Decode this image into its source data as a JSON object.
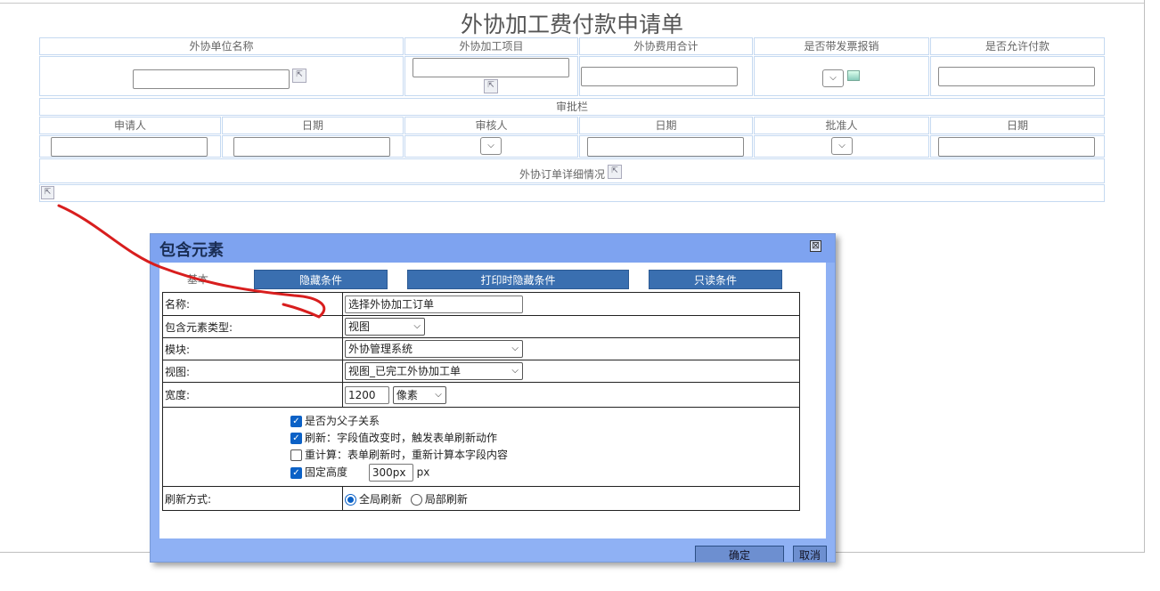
{
  "form": {
    "title": "外协加工费付款申请单",
    "headers": [
      "外协单位名称",
      "外协加工项目",
      "外协费用合计",
      "是否带发票报销",
      "是否允许付款"
    ],
    "approval_title": "审批栏",
    "approval_headers": [
      "申请人",
      "日期",
      "审核人",
      "日期",
      "批准人",
      "日期"
    ],
    "detail_title": "外协订单详细情况"
  },
  "dialog": {
    "title": "包含元素",
    "close_glyph": "⊠",
    "tabs": [
      "基本",
      "隐藏条件",
      "打印时隐藏条件",
      "只读条件"
    ],
    "rows": {
      "name_label": "名称:",
      "name_value": "选择外协加工订单",
      "type_label": "包含元素类型:",
      "type_value": "视图",
      "module_label": "模块:",
      "module_value": "外协管理系统",
      "view_label": "视图:",
      "view_value": "视图_已完工外协加工单",
      "width_label": "宽度:",
      "width_value": "1200",
      "width_unit": "像素",
      "opt_parent": "是否为父子关系",
      "opt_refresh": "刷新：字段值改变时，触发表单刷新动作",
      "opt_recalc": "重计算：表单刷新时，重新计算本字段内容",
      "opt_fixed": "固定高度",
      "fixed_value": "300px",
      "fixed_unit": "px",
      "refresh_label": "刷新方式:",
      "refresh_all": "全局刷新",
      "refresh_part": "局部刷新"
    },
    "checks": {
      "parent": true,
      "refresh": true,
      "recalc": false,
      "fixed": true
    },
    "refresh_mode": "全局刷新",
    "ok": "确定",
    "cancel": "取消"
  },
  "colors": {
    "accent": "#3a6fb0",
    "dialog_header": "#7ea3f0",
    "annotation": "#d81e1e",
    "cell_border": "#c5d9f1"
  }
}
